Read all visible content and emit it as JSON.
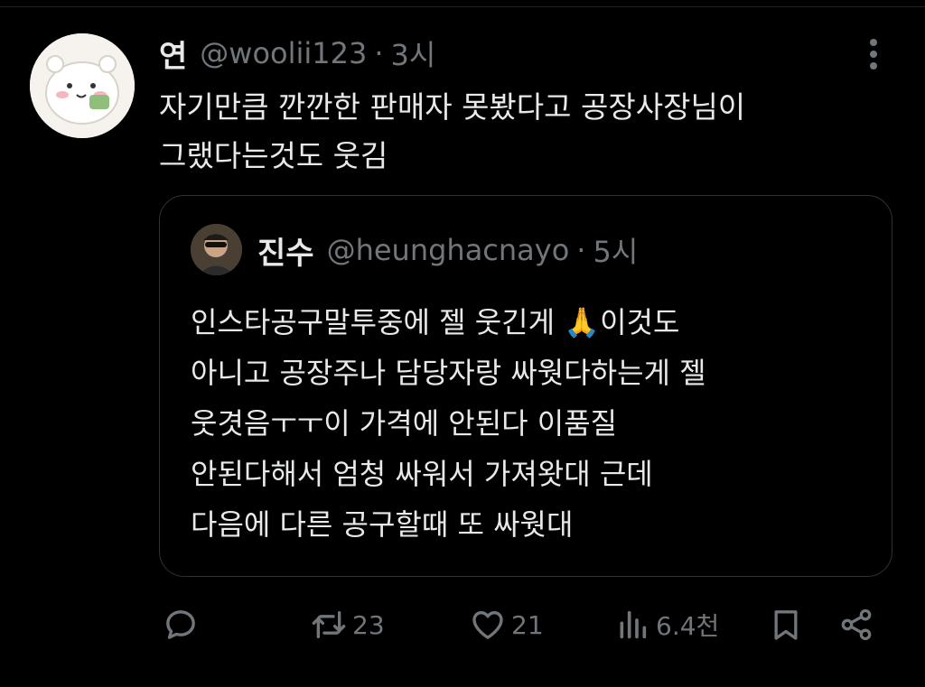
{
  "tweet": {
    "display_name": "연",
    "handle": "@woolii123",
    "separator": "·",
    "time": "3시",
    "text_lines": [
      "자기만큼 깐깐한 판매자 못봤다고 공장사장님이",
      "그랬다는것도 웃김"
    ]
  },
  "quoted_tweet": {
    "display_name": "진수",
    "handle": "@heunghacnayo",
    "separator": "·",
    "time": "5시",
    "text_lines": [
      "인스타공구말투중에 젤 웃긴게 🙏이것도",
      "아니고 공장주나 담당자랑 싸웟다하는게 젤",
      "웃겻음ㅜㅜ이 가격에 안된다 이품질",
      "안된다해서 엄청 싸워서 가져왓대 근데",
      "다음에 다른 공구할때 또 싸웟대"
    ]
  },
  "actions": {
    "reply_icon": "reply-icon",
    "retweet_icon": "retweet-icon",
    "retweet_count": "23",
    "like_icon": "heart-icon",
    "like_count": "21",
    "views_icon": "views-icon",
    "views_count": "6.4천",
    "bookmark_icon": "bookmark-icon",
    "share_icon": "share-icon"
  },
  "colors": {
    "background": "#000000",
    "text_primary": "#e7e9ea",
    "text_secondary": "#71767b",
    "border": "#2f3336"
  }
}
